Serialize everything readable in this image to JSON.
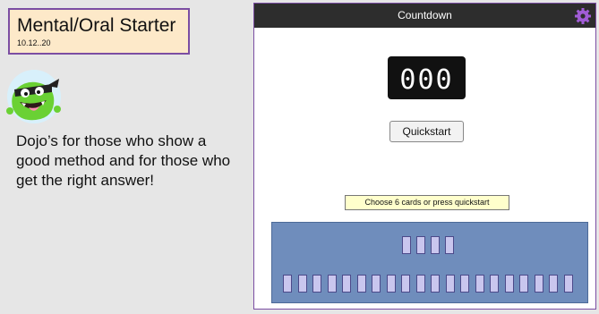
{
  "title_box": {
    "title": "Mental/Oral Starter",
    "date": "10.12..20"
  },
  "avatar": {
    "icon": "dojo-monster-icon",
    "color": "#6ad134"
  },
  "message": "Dojo’s for those who show a good method and for those who get the right answer!",
  "countdown": {
    "header": "Countdown",
    "gear_icon": "gear-icon",
    "accent_color": "#a15cd6",
    "display": "000",
    "quickstart_label": "Quickstart",
    "prompt": "Choose 6 cards or press quickstart",
    "selected_slots": 4,
    "deck_cards": 20
  }
}
